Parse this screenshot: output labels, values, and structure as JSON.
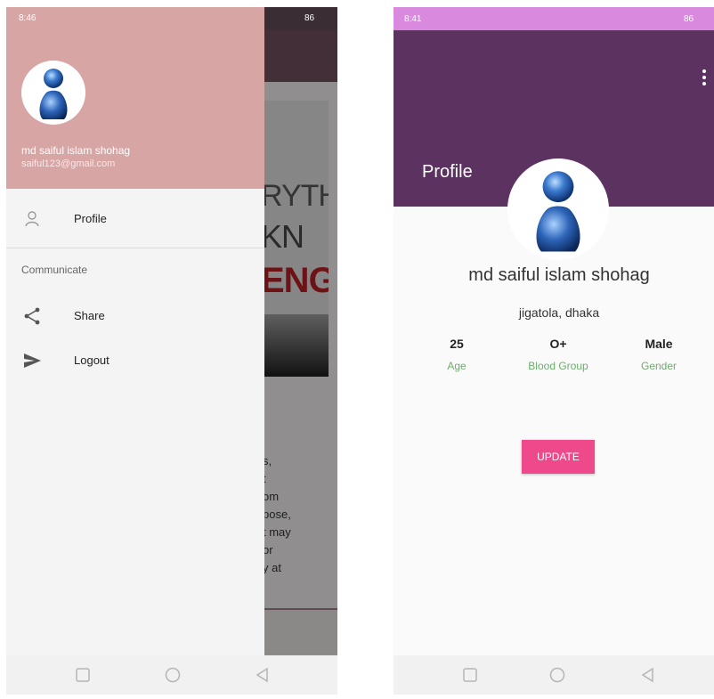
{
  "left_screen": {
    "status_bar": {
      "time": "8:46",
      "battery": "86"
    },
    "drawer": {
      "user_name": "md saiful islam shohag",
      "user_email": "saiful123@gmail.com",
      "items": [
        {
          "label": "Profile",
          "icon": "person-icon"
        },
        {
          "label": "Share",
          "icon": "share-icon"
        },
        {
          "label": "Logout",
          "icon": "send-icon"
        }
      ],
      "section_label": "Communicate"
    },
    "background_content": {
      "image_words": [
        "RYTH",
        "KN",
        "ENG"
      ],
      "text_fragments": [
        "s,",
        "t",
        "om",
        "pose,",
        "t may",
        "or",
        "y at"
      ]
    }
  },
  "right_screen": {
    "status_bar": {
      "time": "8:41",
      "battery": "86"
    },
    "title": "Profile",
    "name": "md saiful islam shohag",
    "address": "jigatola,  dhaka",
    "stats": [
      {
        "value": "25",
        "label": "Age"
      },
      {
        "value": "O+",
        "label": "Blood Group"
      },
      {
        "value": "Male",
        "label": "Gender"
      }
    ],
    "update_button": "UPDATE",
    "colors": {
      "header": "#5c3260",
      "status_bar": "#d98adf",
      "accent": "#ee4a8b",
      "stat_label": "#6cae6c"
    }
  }
}
